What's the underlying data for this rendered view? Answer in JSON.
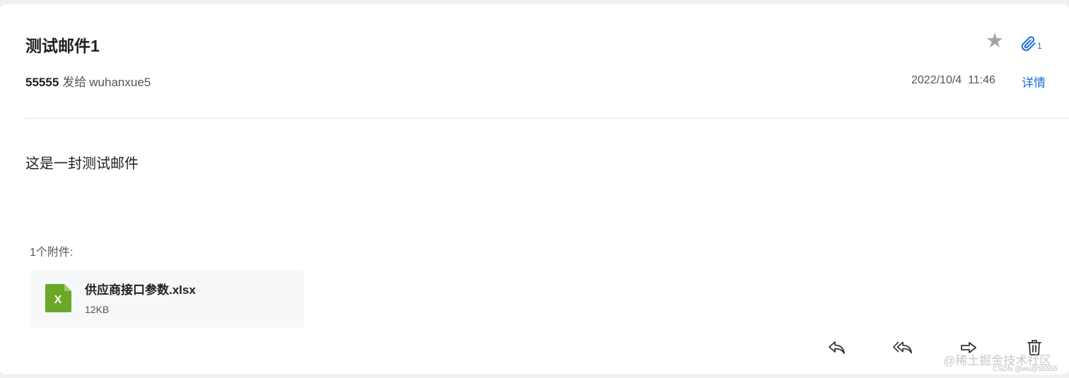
{
  "email": {
    "subject": "测试邮件1",
    "sender": "55555",
    "send_verb": "发给",
    "recipient": "wuhanxue5",
    "date": "2022/10/4",
    "time": "11:46",
    "details_link": "详情",
    "attachment_indicator_count": "1",
    "body": "这是一封测试邮件"
  },
  "attachments": {
    "label": "1个附件:",
    "items": [
      {
        "name": "供应商接口参数.xlsx",
        "size": "12KB",
        "icon": "excel-file-icon",
        "icon_letter": "X",
        "icon_color": "#6aa827"
      }
    ]
  },
  "actions": [
    {
      "name": "reply",
      "icon": "reply-icon"
    },
    {
      "name": "reply-all",
      "icon": "reply-all-icon"
    },
    {
      "name": "forward",
      "icon": "forward-icon"
    },
    {
      "name": "delete",
      "icon": "trash-icon"
    }
  ],
  "colors": {
    "accent": "#1e6fd9",
    "star": "#a3a3a3"
  },
  "watermark": {
    "primary": "@稀土掘金技术社区",
    "secondary": "CSDN @wu@55555"
  }
}
